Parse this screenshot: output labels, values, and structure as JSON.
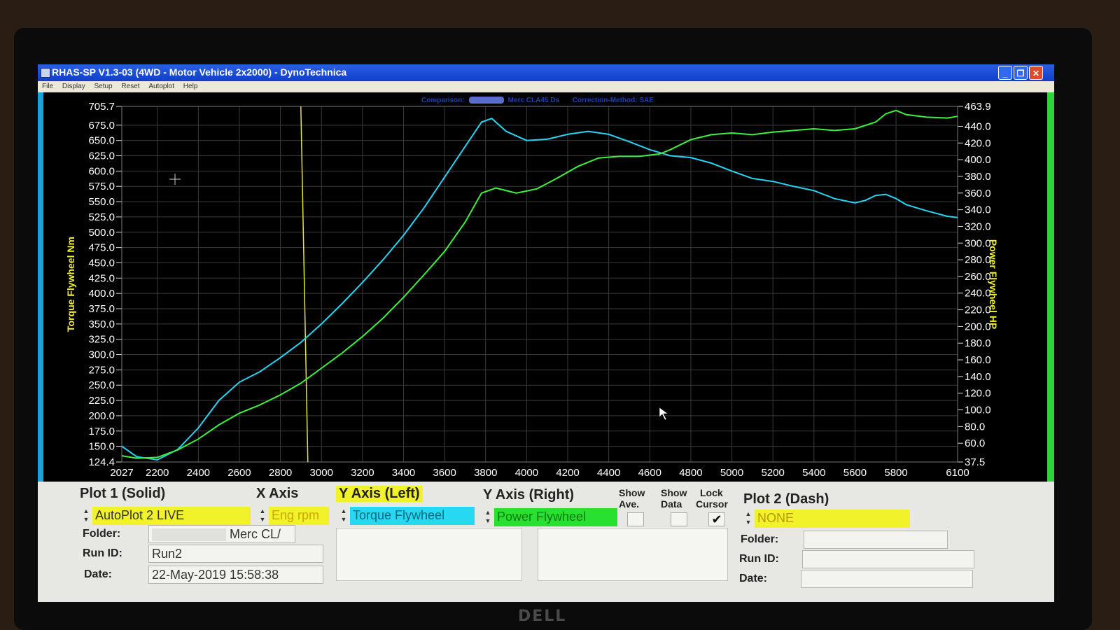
{
  "window": {
    "title": "RHAS-SP V1.3-03  (4WD - Motor Vehicle 2x2000) - DynoTechnica",
    "controls": {
      "minimize": "_",
      "restore": "❐",
      "close": "✕"
    }
  },
  "menu": [
    "File",
    "Display",
    "Setup",
    "Reset",
    "Autoplot",
    "Help"
  ],
  "comparison": {
    "label": "Comparison:",
    "run_name": "Merc CLA45 Ds",
    "correction": "Correction-Method: SAE"
  },
  "chart_data": {
    "type": "line",
    "xlabel": "",
    "ylabel_left": "Torque Flywheel Nm",
    "ylabel_right": "Power Flywheel HP",
    "xlim": [
      2027,
      6100
    ],
    "ylim_left": [
      124.4,
      705.7
    ],
    "ylim_right": [
      37.5,
      463.9
    ],
    "x_tick_labels": [
      "2027",
      "2200",
      "2400",
      "2600",
      "2800",
      "3000",
      "3200",
      "3400",
      "3600",
      "3800",
      "4000",
      "4200",
      "4400",
      "4600",
      "4800",
      "5000",
      "5200",
      "5400",
      "5600",
      "5800",
      "6100"
    ],
    "y_left_tick_labels": [
      "705.7",
      "675.0",
      "650.0",
      "625.0",
      "600.0",
      "575.0",
      "550.0",
      "525.0",
      "500.0",
      "475.0",
      "450.0",
      "425.0",
      "400.0",
      "375.0",
      "350.0",
      "325.0",
      "300.0",
      "275.0",
      "250.0",
      "225.0",
      "200.0",
      "175.0",
      "150.0",
      "124.4"
    ],
    "y_right_tick_labels": [
      "463.9",
      "440.0",
      "420.0",
      "400.0",
      "380.0",
      "360.0",
      "340.0",
      "320.0",
      "300.0",
      "280.0",
      "260.0",
      "240.0",
      "220.0",
      "200.0",
      "180.0",
      "160.0",
      "140.0",
      "120.0",
      "100.0",
      "80.0",
      "60.0",
      "37.5"
    ],
    "grid": true,
    "cursor_x": 2920,
    "series": [
      {
        "name": "Torque Flywheel",
        "axis": "left",
        "color": "#2ad2f2",
        "points": [
          [
            2027,
            150
          ],
          [
            2100,
            133
          ],
          [
            2200,
            128
          ],
          [
            2300,
            145
          ],
          [
            2400,
            180
          ],
          [
            2500,
            225
          ],
          [
            2600,
            255
          ],
          [
            2700,
            272
          ],
          [
            2800,
            295
          ],
          [
            2900,
            320
          ],
          [
            3000,
            350
          ],
          [
            3100,
            383
          ],
          [
            3200,
            418
          ],
          [
            3300,
            455
          ],
          [
            3400,
            495
          ],
          [
            3500,
            540
          ],
          [
            3600,
            590
          ],
          [
            3700,
            640
          ],
          [
            3780,
            680
          ],
          [
            3830,
            686
          ],
          [
            3900,
            665
          ],
          [
            4000,
            650
          ],
          [
            4100,
            652
          ],
          [
            4200,
            660
          ],
          [
            4300,
            665
          ],
          [
            4400,
            660
          ],
          [
            4500,
            648
          ],
          [
            4600,
            635
          ],
          [
            4700,
            625
          ],
          [
            4800,
            622
          ],
          [
            4900,
            613
          ],
          [
            5000,
            600
          ],
          [
            5100,
            588
          ],
          [
            5200,
            583
          ],
          [
            5300,
            575
          ],
          [
            5400,
            568
          ],
          [
            5500,
            555
          ],
          [
            5600,
            548
          ],
          [
            5650,
            552
          ],
          [
            5700,
            560
          ],
          [
            5750,
            562
          ],
          [
            5800,
            555
          ],
          [
            5850,
            545
          ],
          [
            5950,
            535
          ],
          [
            6050,
            526
          ],
          [
            6100,
            524
          ]
        ]
      },
      {
        "name": "Power Flywheel",
        "axis": "right",
        "color": "#3ef03e",
        "points": [
          [
            2027,
            45
          ],
          [
            2100,
            42
          ],
          [
            2200,
            43
          ],
          [
            2300,
            52
          ],
          [
            2400,
            65
          ],
          [
            2500,
            82
          ],
          [
            2600,
            96
          ],
          [
            2700,
            106
          ],
          [
            2800,
            118
          ],
          [
            2900,
            132
          ],
          [
            3000,
            150
          ],
          [
            3100,
            168
          ],
          [
            3200,
            188
          ],
          [
            3300,
            210
          ],
          [
            3400,
            235
          ],
          [
            3500,
            262
          ],
          [
            3600,
            290
          ],
          [
            3700,
            325
          ],
          [
            3780,
            360
          ],
          [
            3850,
            366
          ],
          [
            3950,
            360
          ],
          [
            4050,
            365
          ],
          [
            4150,
            378
          ],
          [
            4250,
            392
          ],
          [
            4350,
            402
          ],
          [
            4450,
            404
          ],
          [
            4550,
            404
          ],
          [
            4650,
            407
          ],
          [
            4700,
            412
          ],
          [
            4800,
            424
          ],
          [
            4900,
            430
          ],
          [
            5000,
            432
          ],
          [
            5100,
            430
          ],
          [
            5200,
            433
          ],
          [
            5300,
            435
          ],
          [
            5400,
            437
          ],
          [
            5500,
            435
          ],
          [
            5600,
            437
          ],
          [
            5700,
            445
          ],
          [
            5750,
            455
          ],
          [
            5800,
            459
          ],
          [
            5850,
            454
          ],
          [
            5950,
            451
          ],
          [
            6050,
            450
          ],
          [
            6100,
            452
          ]
        ]
      }
    ]
  },
  "panel": {
    "plot1": {
      "heading": "Plot 1 (Solid)",
      "value": "AutoPlot 2 LIVE"
    },
    "x_axis": {
      "heading": "X Axis",
      "value": "Eng rpm"
    },
    "y_left": {
      "heading": "Y Axis (Left)",
      "value": "Torque Flywheel"
    },
    "y_right": {
      "heading": "Y Axis (Right)",
      "value": "Power Flywheel"
    },
    "show_ave": {
      "label_1": "Show",
      "label_2": "Ave.",
      "checked": false
    },
    "show_data": {
      "label_1": "Show",
      "label_2": "Data",
      "checked": false
    },
    "lock_cursor": {
      "label_1": "Lock",
      "label_2": "Cursor",
      "checked": true,
      "mark": "✔"
    },
    "plot2": {
      "heading": "Plot 2 (Dash)",
      "value": "NONE"
    },
    "left_info": {
      "folder_label": "Folder:",
      "folder_value": "Merc CL/",
      "runid_label": "Run ID:",
      "runid_value": "Run2",
      "date_label": "Date:",
      "date_value": "22-May-2019  15:58:38"
    },
    "right_info": {
      "folder_label": "Folder:",
      "runid_label": "Run ID:",
      "date_label": "Date:"
    },
    "colors": {
      "yellow": "#f2f22a",
      "cyan": "#27d8f2",
      "green": "#28e030"
    }
  },
  "monitor_brand": "DELL"
}
